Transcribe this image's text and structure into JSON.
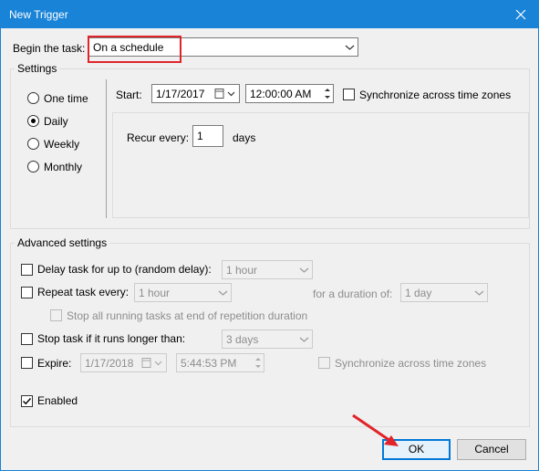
{
  "window": {
    "title": "New Trigger"
  },
  "begin": {
    "label": "Begin the task:",
    "value": "On a schedule"
  },
  "settings": {
    "legend": "Settings",
    "radios": [
      {
        "label": "One time",
        "selected": false
      },
      {
        "label": "Daily",
        "selected": true
      },
      {
        "label": "Weekly",
        "selected": false
      },
      {
        "label": "Monthly",
        "selected": false
      }
    ],
    "start_label": "Start:",
    "start_date": "1/17/2017",
    "start_time": "12:00:00 AM",
    "sync_label": "Synchronize across time zones",
    "recur_label": "Recur every:",
    "recur_value": "1",
    "recur_unit": "days"
  },
  "advanced": {
    "legend": "Advanced settings",
    "delay_label": "Delay task for up to (random delay):",
    "delay_value": "1 hour",
    "repeat_label": "Repeat task every:",
    "repeat_value": "1 hour",
    "duration_label": "for a duration of:",
    "duration_value": "1 day",
    "stop_running_label": "Stop all running tasks at end of repetition duration",
    "stop_longer_label": "Stop task if it runs longer than:",
    "stop_longer_value": "3 days",
    "expire_label": "Expire:",
    "expire_date": "1/17/2018",
    "expire_time": "5:44:53 PM",
    "expire_sync_label": "Synchronize across time zones",
    "enabled_label": "Enabled"
  },
  "buttons": {
    "ok": "OK",
    "cancel": "Cancel"
  },
  "colors": {
    "titlebar": "#1883d7",
    "highlight": "#e0242a",
    "arrow": "#e0242a"
  }
}
